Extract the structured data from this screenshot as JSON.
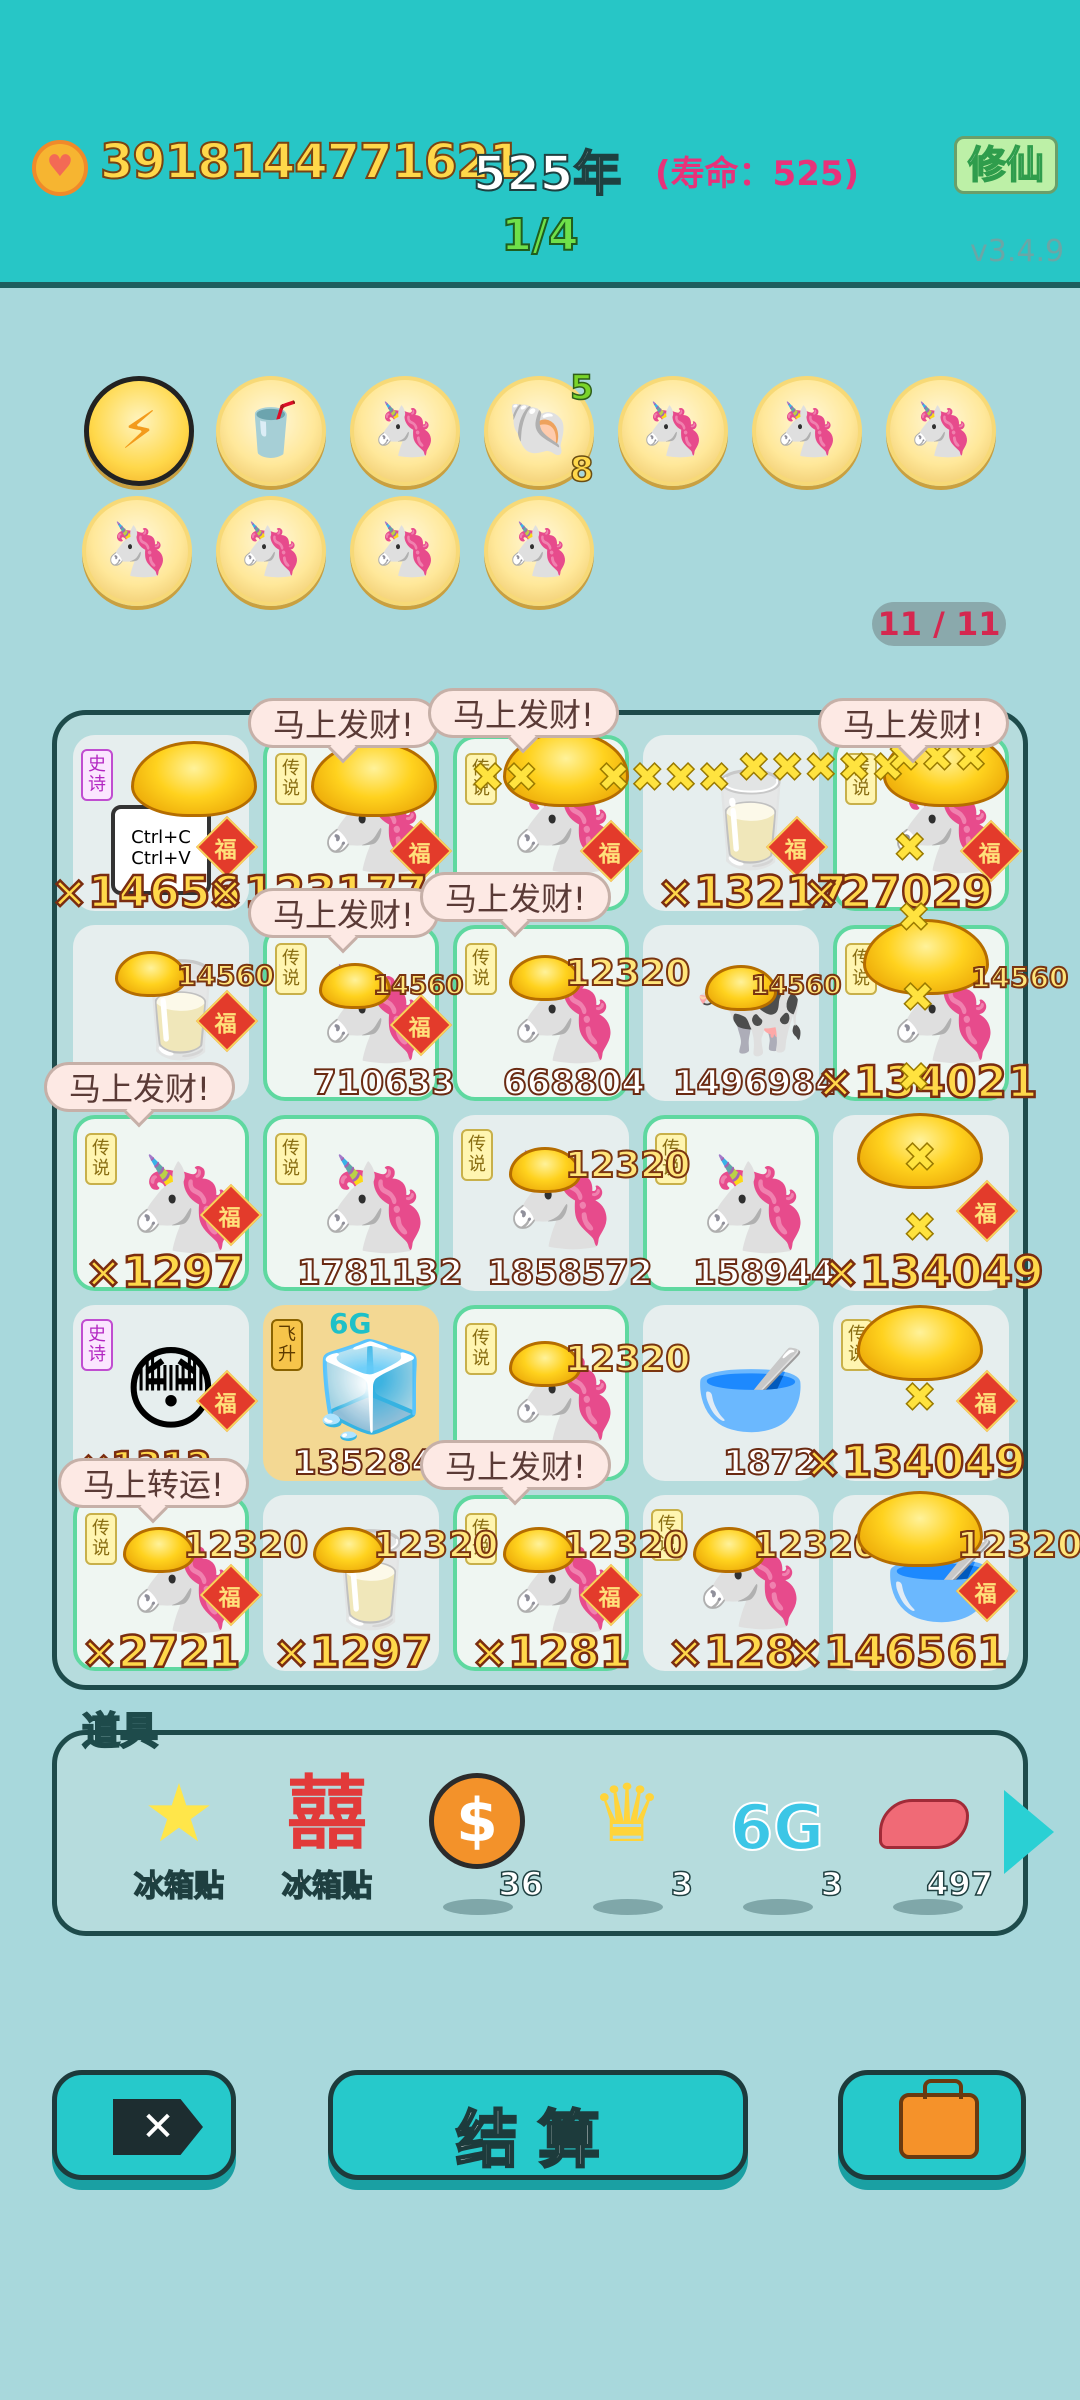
{
  "header": {
    "coins": "3918144771621",
    "year": "525年",
    "lifespan": "(寿命：525)",
    "cultivate_button": "修仙",
    "progress": "1/4",
    "version": "v3.4.9"
  },
  "relics": {
    "shell_top_count": "5",
    "shell_bottom_count": "8",
    "icons": [
      "lightning-icon",
      "bubble-tea-icon",
      "unicorn-icon",
      "shell-icon",
      "unicorn-icon",
      "unicorn-icon",
      "unicorn-icon",
      "unicorn-icon",
      "unicorn-icon",
      "unicorn-icon",
      "unicorn-icon"
    ]
  },
  "pager": "11 / 11",
  "board": {
    "tags": {
      "epic": "史诗",
      "legend": "传说",
      "ascend": "飞升"
    },
    "bubbles": {
      "fortune": "马上发财!",
      "luck": "马上转运!"
    },
    "fu_char": "福",
    "signal_6g": "6G",
    "ctrl_c": "Ctrl+C",
    "ctrl_v": "Ctrl+V",
    "row1": [
      "×14656",
      "×123177",
      "",
      "×13217",
      "×27029"
    ],
    "row2": [
      "",
      "710633",
      "668804",
      "1496984",
      "×134021"
    ],
    "row2_float": [
      "14560",
      "14560",
      "12320",
      "14560",
      "14560"
    ],
    "row3": [
      "×1297",
      "1781132",
      "1858572",
      "158944",
      "×134049"
    ],
    "row3_float": [
      "12320"
    ],
    "row4": [
      "×1312",
      "1352840",
      "",
      "1872",
      "×134049"
    ],
    "row4_float": [
      "12320"
    ],
    "row5": [
      "×2721",
      "×1297",
      "×1281",
      "×128",
      "×146561"
    ],
    "row5_float": [
      "12320",
      "12320",
      "12320",
      "12320",
      "12320"
    ]
  },
  "items": {
    "title": "道具",
    "list": [
      {
        "icon": "star-sticker-icon",
        "label": "冰箱贴",
        "count": ""
      },
      {
        "icon": "double-happiness-icon",
        "label": "冰箱贴",
        "count": ""
      },
      {
        "icon": "dollar-coin-icon",
        "label": "",
        "count": "36"
      },
      {
        "icon": "crown-icon",
        "label": "",
        "count": "3"
      },
      {
        "icon": "6g-icon",
        "label": "",
        "count": "3"
      },
      {
        "icon": "liver-icon",
        "label": "",
        "count": "497"
      }
    ]
  },
  "buttons": {
    "settle": "结算"
  }
}
